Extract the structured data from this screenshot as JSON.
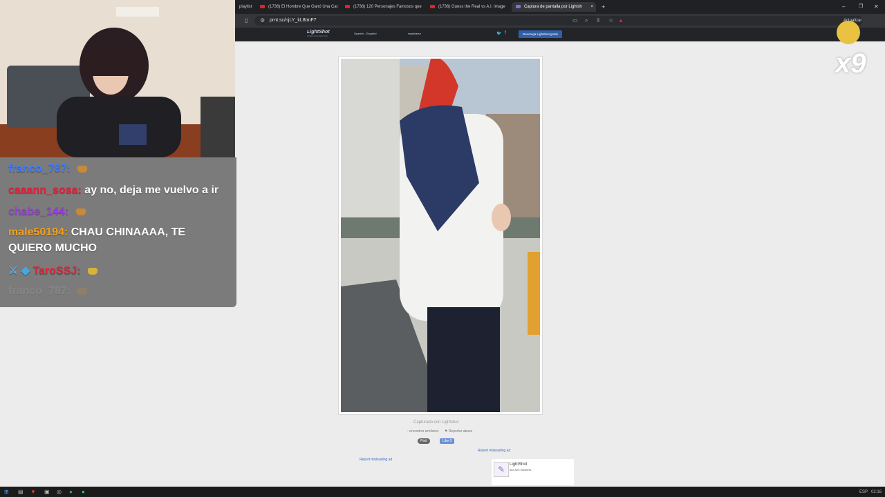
{
  "browser": {
    "tabs": [
      {
        "label": "playlist"
      },
      {
        "label": "(1736) El Hombre Que Ganó Una Car"
      },
      {
        "label": "(1736) 120 Personajes Famosos que"
      },
      {
        "label": "(1736) Guess the Real vs A.I. Image"
      },
      {
        "label": "Captura de pantalla por Lightsh"
      }
    ],
    "url": "prnt.sc/njLY_kL8tmF7",
    "update_label": "Actualizar"
  },
  "lightshot": {
    "logo": "LightShot",
    "tagline": "simple screenshot tool",
    "language": "Spanish - Español",
    "login": "registrarse",
    "download_button": "Descarga Lightshot gratis"
  },
  "page": {
    "captured_with": "Capturado con Lightshot",
    "find_similar": "encontrar similares",
    "report_abuse": "Reportar abuso",
    "pin_button": "Pinit",
    "like_button": "Like 0",
    "report_ad_1": "Report misleading ad",
    "report_ad_2": "Report misleading ad",
    "follow_name": "LightShot",
    "follow_count": "383,923 followers"
  },
  "chat": [
    {
      "user": "franco_787:",
      "message": "",
      "color": "#3d7cff",
      "emote": true
    },
    {
      "user": "caaann_sosa:",
      "message": "ay no, deja me vuelvo a ir",
      "color": "#e0243c",
      "emote": false
    },
    {
      "user": "chabe_144:",
      "message": "",
      "color": "#9b3de0",
      "emote": true
    },
    {
      "user": "male50194:",
      "message": "CHAU CHINAAAA, TE",
      "color": "#f0a020",
      "emote": false
    },
    {
      "user": "",
      "message": "QUIERO MUCHO",
      "color": "#ffffff",
      "emote": false
    },
    {
      "user": "TaroSSJ:",
      "message": "",
      "color": "#e0243c",
      "emote": true
    },
    {
      "user": "franco_787:",
      "message": "",
      "color": "#aaaaaa",
      "emote": true
    }
  ],
  "overlay": {
    "multiplier": "x9"
  },
  "taskbar": {
    "lang": "ESP",
    "time": "02:16"
  }
}
